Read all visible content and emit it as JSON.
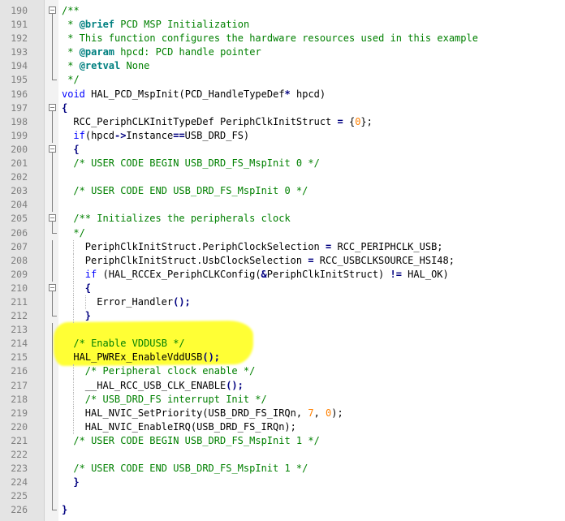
{
  "editor": {
    "highlight_color": "#ffff1a",
    "colors": {
      "comment": "#008000",
      "keyword": "#0000ff",
      "number": "#ff8000",
      "doc_tag": "#008080",
      "line_number": "#808080"
    },
    "lines": [
      {
        "n": "190",
        "fold": "open",
        "indent": 0,
        "parts": [
          {
            "t": "/**",
            "c": "comment"
          }
        ]
      },
      {
        "n": "191",
        "fold": "line",
        "indent": 0,
        "parts": [
          {
            "t": " * ",
            "c": "comment"
          },
          {
            "t": "@brief",
            "c": "doc"
          },
          {
            "t": " PCD MSP Initialization",
            "c": "comment"
          }
        ]
      },
      {
        "n": "192",
        "fold": "line",
        "indent": 0,
        "parts": [
          {
            "t": " * This function configures the hardware resources used in this example",
            "c": "comment"
          }
        ]
      },
      {
        "n": "193",
        "fold": "line",
        "indent": 0,
        "parts": [
          {
            "t": " * ",
            "c": "comment"
          },
          {
            "t": "@param",
            "c": "doc"
          },
          {
            "t": " hpcd: PCD handle pointer",
            "c": "comment"
          }
        ]
      },
      {
        "n": "194",
        "fold": "line",
        "indent": 0,
        "parts": [
          {
            "t": " * ",
            "c": "comment"
          },
          {
            "t": "@retval",
            "c": "doc"
          },
          {
            "t": " None",
            "c": "comment"
          }
        ]
      },
      {
        "n": "195",
        "fold": "end",
        "indent": 0,
        "parts": [
          {
            "t": " */",
            "c": "comment"
          }
        ]
      },
      {
        "n": "196",
        "fold": "",
        "indent": 0,
        "parts": [
          {
            "t": "void",
            "c": "kw"
          },
          {
            "t": " HAL_PCD_MspInit(PCD_HandleTypeDef",
            "c": ""
          },
          {
            "t": "*",
            "c": "op"
          },
          {
            "t": " hpcd)",
            "c": ""
          }
        ]
      },
      {
        "n": "197",
        "fold": "open",
        "indent": 0,
        "parts": [
          {
            "t": "{",
            "c": "op"
          }
        ]
      },
      {
        "n": "198",
        "fold": "line",
        "indent": 2,
        "parts": [
          {
            "t": "RCC_PeriphCLKInitTypeDef PeriphClkInitStruct ",
            "c": ""
          },
          {
            "t": "=",
            "c": "op"
          },
          {
            "t": " {",
            "c": ""
          },
          {
            "t": "0",
            "c": "num"
          },
          {
            "t": "};",
            "c": ""
          }
        ]
      },
      {
        "n": "199",
        "fold": "line",
        "indent": 2,
        "parts": [
          {
            "t": "if",
            "c": "kw"
          },
          {
            "t": "(hpcd",
            "c": ""
          },
          {
            "t": "->",
            "c": "op"
          },
          {
            "t": "Instance",
            "c": ""
          },
          {
            "t": "==",
            "c": "op"
          },
          {
            "t": "USB_DRD_FS)",
            "c": ""
          }
        ]
      },
      {
        "n": "200",
        "fold": "open",
        "indent": 2,
        "parts": [
          {
            "t": "{",
            "c": "op"
          }
        ]
      },
      {
        "n": "201",
        "fold": "line",
        "indent": 2,
        "parts": [
          {
            "t": "/* USER CODE BEGIN USB_DRD_FS_MspInit 0 */",
            "c": "comment"
          }
        ]
      },
      {
        "n": "202",
        "fold": "line",
        "indent": 0,
        "parts": []
      },
      {
        "n": "203",
        "fold": "line",
        "indent": 2,
        "parts": [
          {
            "t": "/* USER CODE END USB_DRD_FS_MspInit 0 */",
            "c": "comment"
          }
        ]
      },
      {
        "n": "204",
        "fold": "line",
        "indent": 0,
        "parts": []
      },
      {
        "n": "205",
        "fold": "open",
        "indent": 2,
        "parts": [
          {
            "t": "/** Initializes the peripherals clock",
            "c": "comment"
          }
        ]
      },
      {
        "n": "206",
        "fold": "end",
        "indent": 2,
        "parts": [
          {
            "t": "*/",
            "c": "comment"
          }
        ]
      },
      {
        "n": "207",
        "fold": "line",
        "indent": 4,
        "parts": [
          {
            "t": "PeriphClkInitStruct.PeriphClockSelection ",
            "c": ""
          },
          {
            "t": "=",
            "c": "op"
          },
          {
            "t": " RCC_PERIPHCLK_USB;",
            "c": ""
          }
        ]
      },
      {
        "n": "208",
        "fold": "line",
        "indent": 4,
        "parts": [
          {
            "t": "PeriphClkInitStruct.UsbClockSelection ",
            "c": ""
          },
          {
            "t": "=",
            "c": "op"
          },
          {
            "t": " RCC_USBCLKSOURCE_HSI48;",
            "c": ""
          }
        ]
      },
      {
        "n": "209",
        "fold": "line",
        "indent": 4,
        "parts": [
          {
            "t": "if",
            "c": "kw"
          },
          {
            "t": " (HAL_RCCEx_PeriphCLKConfig(",
            "c": ""
          },
          {
            "t": "&",
            "c": "op"
          },
          {
            "t": "PeriphClkInitStruct) ",
            "c": ""
          },
          {
            "t": "!=",
            "c": "op"
          },
          {
            "t": " HAL_OK)",
            "c": ""
          }
        ]
      },
      {
        "n": "210",
        "fold": "open",
        "indent": 4,
        "parts": [
          {
            "t": "{",
            "c": "op"
          }
        ]
      },
      {
        "n": "211",
        "fold": "line",
        "indent": 6,
        "parts": [
          {
            "t": "Error_Handler",
            "c": ""
          },
          {
            "t": "();",
            "c": "op"
          }
        ]
      },
      {
        "n": "212",
        "fold": "end",
        "indent": 4,
        "parts": [
          {
            "t": "}",
            "c": "op"
          }
        ]
      },
      {
        "n": "213",
        "fold": "line",
        "indent": 0,
        "parts": []
      },
      {
        "n": "214",
        "fold": "line",
        "indent": 2,
        "parts": [
          {
            "t": "/* Enable VDDUSB */",
            "c": "comment"
          }
        ]
      },
      {
        "n": "215",
        "fold": "line",
        "indent": 2,
        "parts": [
          {
            "t": "HAL_PWREx_EnableVddUSB",
            "c": ""
          },
          {
            "t": "();",
            "c": "op"
          }
        ]
      },
      {
        "n": "216",
        "fold": "line",
        "indent": 4,
        "parts": [
          {
            "t": "/* Peripheral clock enable */",
            "c": "comment"
          }
        ]
      },
      {
        "n": "217",
        "fold": "line",
        "indent": 4,
        "parts": [
          {
            "t": "__HAL_RCC_USB_CLK_ENABLE",
            "c": ""
          },
          {
            "t": "();",
            "c": "op"
          }
        ]
      },
      {
        "n": "218",
        "fold": "line",
        "indent": 4,
        "parts": [
          {
            "t": "/* USB_DRD_FS interrupt Init */",
            "c": "comment"
          }
        ]
      },
      {
        "n": "219",
        "fold": "line",
        "indent": 4,
        "parts": [
          {
            "t": "HAL_NVIC_SetPriority(USB_DRD_FS_IRQn, ",
            "c": ""
          },
          {
            "t": "7",
            "c": "num"
          },
          {
            "t": ", ",
            "c": ""
          },
          {
            "t": "0",
            "c": "num"
          },
          {
            "t": ");",
            "c": ""
          }
        ]
      },
      {
        "n": "220",
        "fold": "line",
        "indent": 4,
        "parts": [
          {
            "t": "HAL_NVIC_EnableIRQ(USB_DRD_FS_IRQn);",
            "c": ""
          }
        ]
      },
      {
        "n": "221",
        "fold": "line",
        "indent": 2,
        "parts": [
          {
            "t": "/* USER CODE BEGIN USB_DRD_FS_MspInit 1 */",
            "c": "comment"
          }
        ]
      },
      {
        "n": "222",
        "fold": "line",
        "indent": 0,
        "parts": []
      },
      {
        "n": "223",
        "fold": "line",
        "indent": 2,
        "parts": [
          {
            "t": "/* USER CODE END USB_DRD_FS_MspInit 1 */",
            "c": "comment"
          }
        ]
      },
      {
        "n": "224",
        "fold": "line",
        "indent": 2,
        "parts": [
          {
            "t": "}",
            "c": "op"
          }
        ]
      },
      {
        "n": "225",
        "fold": "line",
        "indent": 0,
        "parts": []
      },
      {
        "n": "226",
        "fold": "end",
        "indent": 0,
        "parts": [
          {
            "t": "}",
            "c": "op"
          }
        ]
      }
    ]
  }
}
